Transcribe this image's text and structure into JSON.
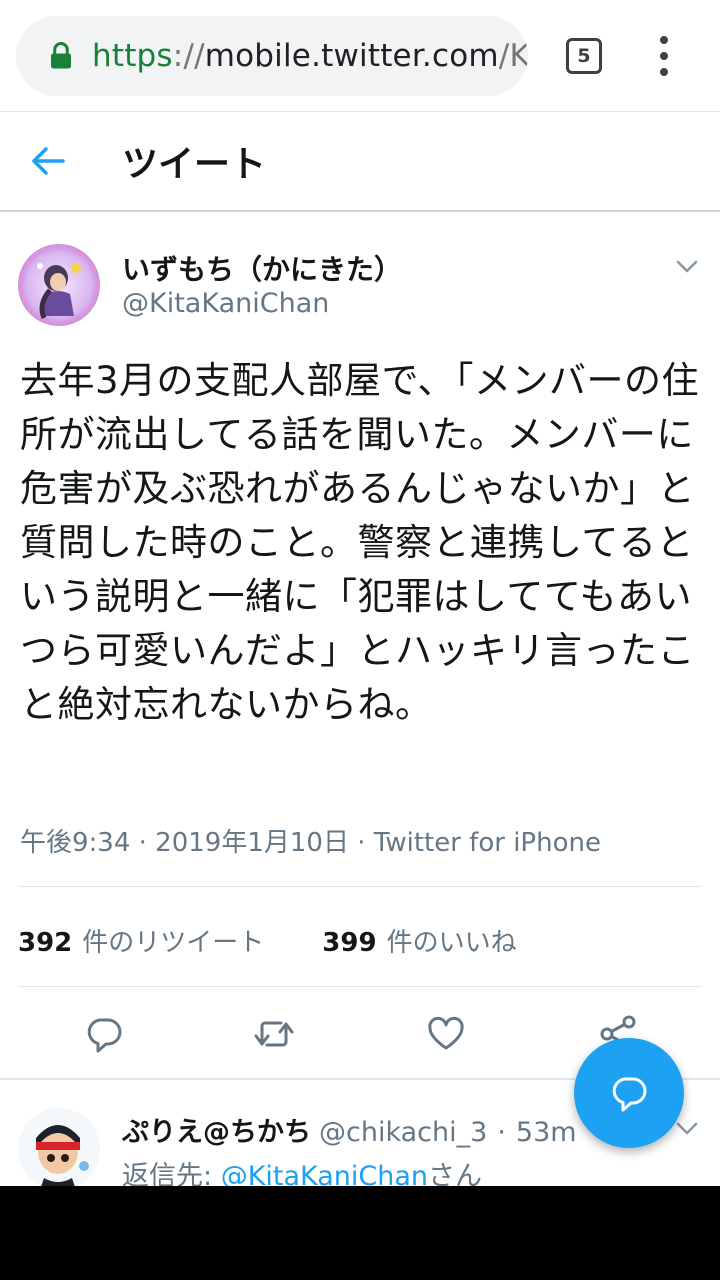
{
  "browser": {
    "url_scheme": "https",
    "url_separator": "://",
    "url_host": "mobile.twitter.com",
    "url_path": "/Kit",
    "tab_count": "5"
  },
  "header": {
    "title": "ツイート"
  },
  "tweet": {
    "author_name": "いずもち（かにきた）",
    "author_handle": "@KitaKaniChan",
    "text": "去年3月の支配人部屋で、「メンバーの住所が流出してる話を聞いた。メンバーに危害が及ぶ恐れがあるんじゃないか」と質問した時のこと。警察と連携してるという説明と一緒に「犯罪はしててもあいつら可愛いんだよ」とハッキリ言ったこと絶対忘れないからね。",
    "meta": "午後9:34 · 2019年1月10日 · Twitter for iPhone",
    "retweet_count": "392",
    "retweet_label": "件のリツイート",
    "like_count": "399",
    "like_label": "件のいいね"
  },
  "actions": {
    "reply_icon": "reply-icon",
    "retweet_icon": "retweet-icon",
    "like_icon": "heart-icon",
    "share_icon": "share-icon"
  },
  "reply": {
    "name": "ぷりえ@ちかち",
    "handle": "@chikachi_3",
    "separator": "·",
    "time": "53m",
    "reply_prefix": "返信先: ",
    "reply_mention": "@KitaKaniChan",
    "reply_suffix": "さん"
  },
  "colors": {
    "accent": "#1da1f2",
    "secure": "#188038",
    "muted_text": "#657786"
  }
}
